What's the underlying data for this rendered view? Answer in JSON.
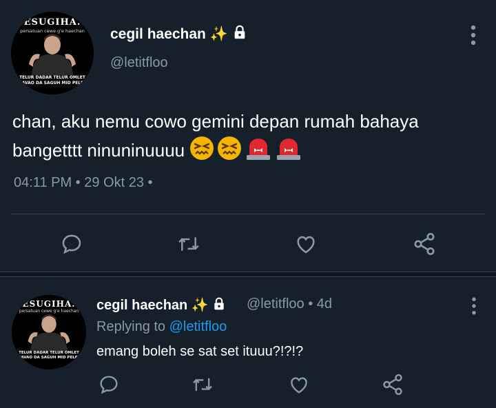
{
  "main_tweet": {
    "avatar": {
      "title": "ESUGIHA.",
      "subtitle": "persatuan cewe g'e haechan",
      "caption_line1": "TELUR DADAR TELUR OMLET",
      "caption_line2": "HAVAO DA SAGUH MID PELET"
    },
    "display_name": "cegil haechan",
    "sparkle": "✨",
    "handle": "@letitfloo",
    "text": "chan, aku nemu cowo gemini depan rumah bahaya bangetttt ninuninuuuu",
    "emojis": [
      "confounded",
      "confounded",
      "police-light",
      "police-light"
    ],
    "timestamp": "04:11 PM • 29 Okt 23 •"
  },
  "reply_tweet": {
    "avatar": {
      "title": "ESUGIHA.",
      "subtitle": "persatuan cewe g'e haechan",
      "caption_line1": "TELUR DADAR TELUR OMLET",
      "caption_line2": "HAVAO DA SAGUH MID PELET"
    },
    "display_name": "cegil haechan",
    "sparkle": "✨",
    "handle_time": "@letitfloo • 4d",
    "replying_prefix": "Replying to",
    "replying_mention": "@letitfloo",
    "text": "emang boleh se sat set ituuu?!?!?"
  },
  "colors": {
    "background": "#15202b",
    "secondary_text": "#8b98a5",
    "accent": "#1d9bf0",
    "divider": "#38444d"
  },
  "icons": [
    "reply-icon",
    "retweet-icon",
    "like-icon",
    "share-icon",
    "more-icon",
    "lock-icon"
  ]
}
